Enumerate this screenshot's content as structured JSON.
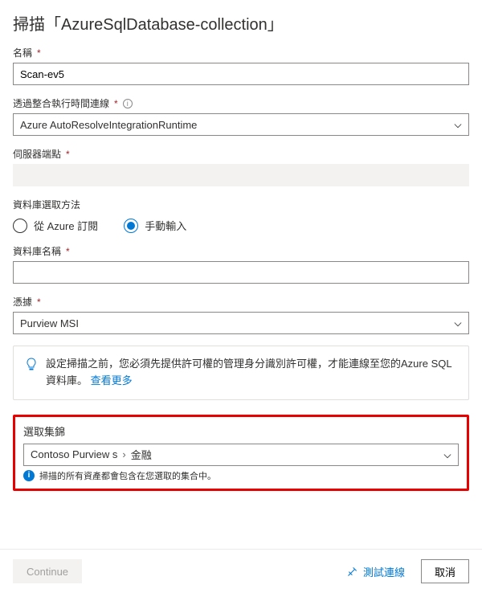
{
  "title": "掃描「AzureSqlDatabase-collection」",
  "fields": {
    "name": {
      "label": "名稱",
      "value": "Scan-ev5"
    },
    "runtime": {
      "label": "透過整合執行時間連線",
      "value": "Azure AutoResolveIntegrationRuntime"
    },
    "endpoint": {
      "label": "伺服器端點",
      "value": ""
    },
    "selectMethod": {
      "label": "資料庫選取方法"
    },
    "radioFromAzure": "從 Azure 訂閱",
    "radioManual": "手動輸入",
    "dbName": {
      "label": "資料庫名稱",
      "value": ""
    },
    "credential": {
      "label": "憑據",
      "value": "Purview MSI"
    }
  },
  "infoBox": {
    "text": "設定掃描之前，您必須先提供許可權的管理身分識別許可權，才能連線至您的Azure SQL 資料庫。",
    "link": "查看更多"
  },
  "collection": {
    "label": "選取集錦",
    "path": [
      "Contoso Purview s",
      "金融"
    ],
    "note": "掃描的所有資產都會包含在您選取的集合中。"
  },
  "footer": {
    "continue": "Continue",
    "test": "測試連線",
    "cancel": "取消"
  }
}
